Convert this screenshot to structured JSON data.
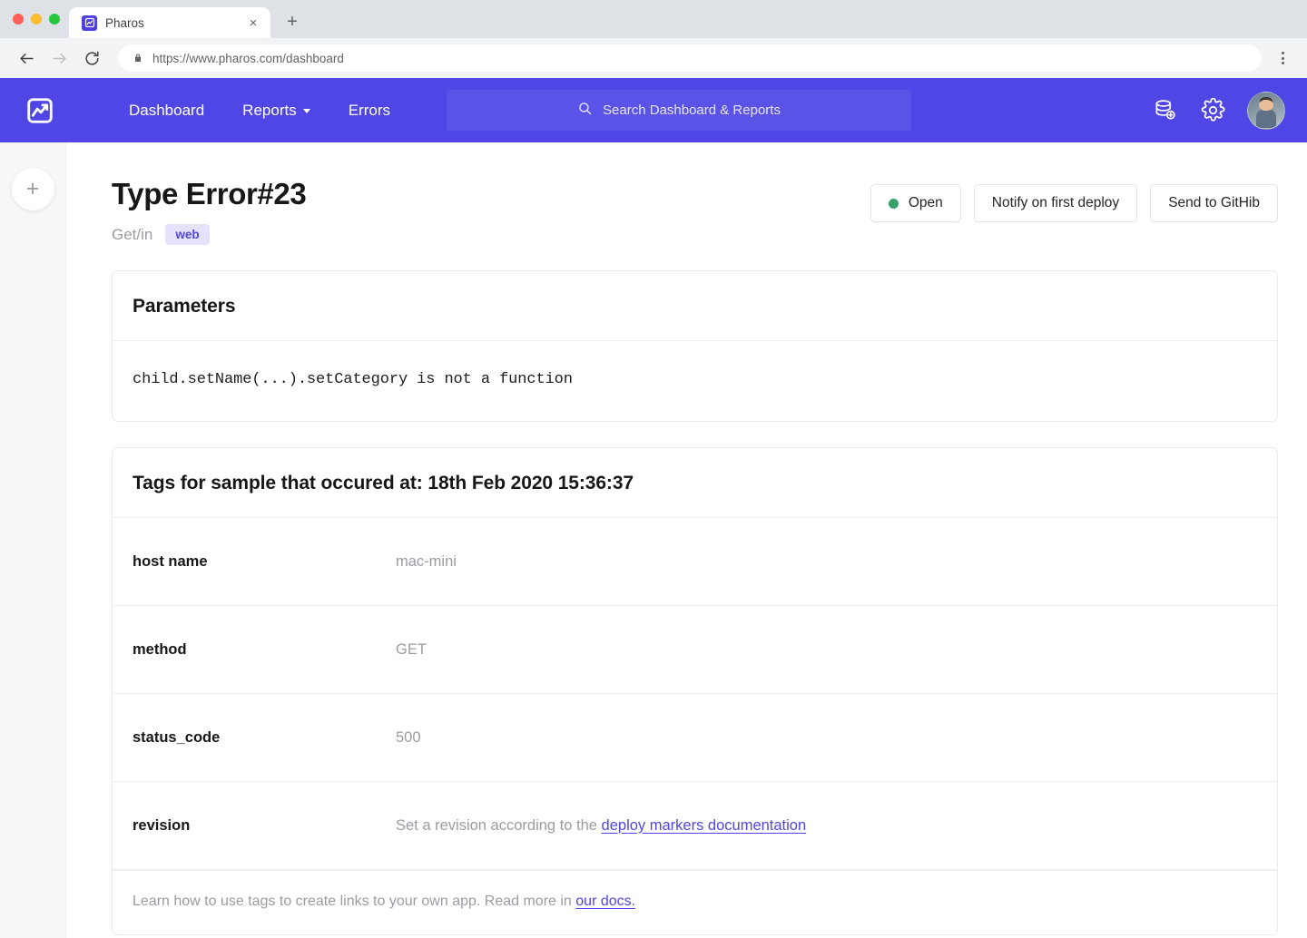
{
  "browser": {
    "tab": {
      "title": "Pharos",
      "favicon": "pharos-logo-icon",
      "close": "×"
    },
    "newtab_label": "+",
    "url": "https://www.pharos.com/dashboard",
    "back_icon": "back-arrow-icon",
    "forward_icon": "forward-arrow-icon",
    "reload_icon": "reload-icon",
    "lock_icon": "lock-icon",
    "menu_icon": "kebab-menu-icon"
  },
  "appnav": {
    "logo": "pharos-logo-icon",
    "links": [
      {
        "label": "Dashboard",
        "has_caret": false
      },
      {
        "label": "Reports",
        "has_caret": true
      },
      {
        "label": "Errors",
        "has_caret": false
      }
    ],
    "search": {
      "placeholder": "Search Dashboard & Reports",
      "icon": "search-icon"
    },
    "icons": [
      {
        "name": "database-add-icon"
      },
      {
        "name": "gear-icon"
      }
    ],
    "avatar": "user-avatar",
    "accent_color": "#4f46e5",
    "search_bg": "#5b52e8"
  },
  "sidebar": {
    "add_label": "+"
  },
  "header": {
    "title": "Type Error#23",
    "route": "Get/in",
    "badge": "web",
    "badge_bg": "#e5e3fb",
    "badge_color": "#4f46e5"
  },
  "actions": {
    "status": {
      "label": "Open",
      "dot_color": "#35a169"
    },
    "notify": "Notify on first deploy",
    "github": "Send to GitHib"
  },
  "parameters": {
    "title": "Parameters",
    "message": "child.setName(...).setCategory is not a function"
  },
  "tags": {
    "title": "Tags for sample that occured at: 18th Feb 2020 15:36:37",
    "rows": [
      {
        "key": "host name",
        "value": "mac-mini"
      },
      {
        "key": "method",
        "value": "GET"
      },
      {
        "key": "status_code",
        "value": "500"
      }
    ],
    "revision": {
      "key": "revision",
      "text": "Set a revision according to the ",
      "link": "deploy markers documentation"
    },
    "footer": {
      "text": "Learn how to use tags to create links to your own app. Read more in ",
      "link": "our docs."
    }
  }
}
